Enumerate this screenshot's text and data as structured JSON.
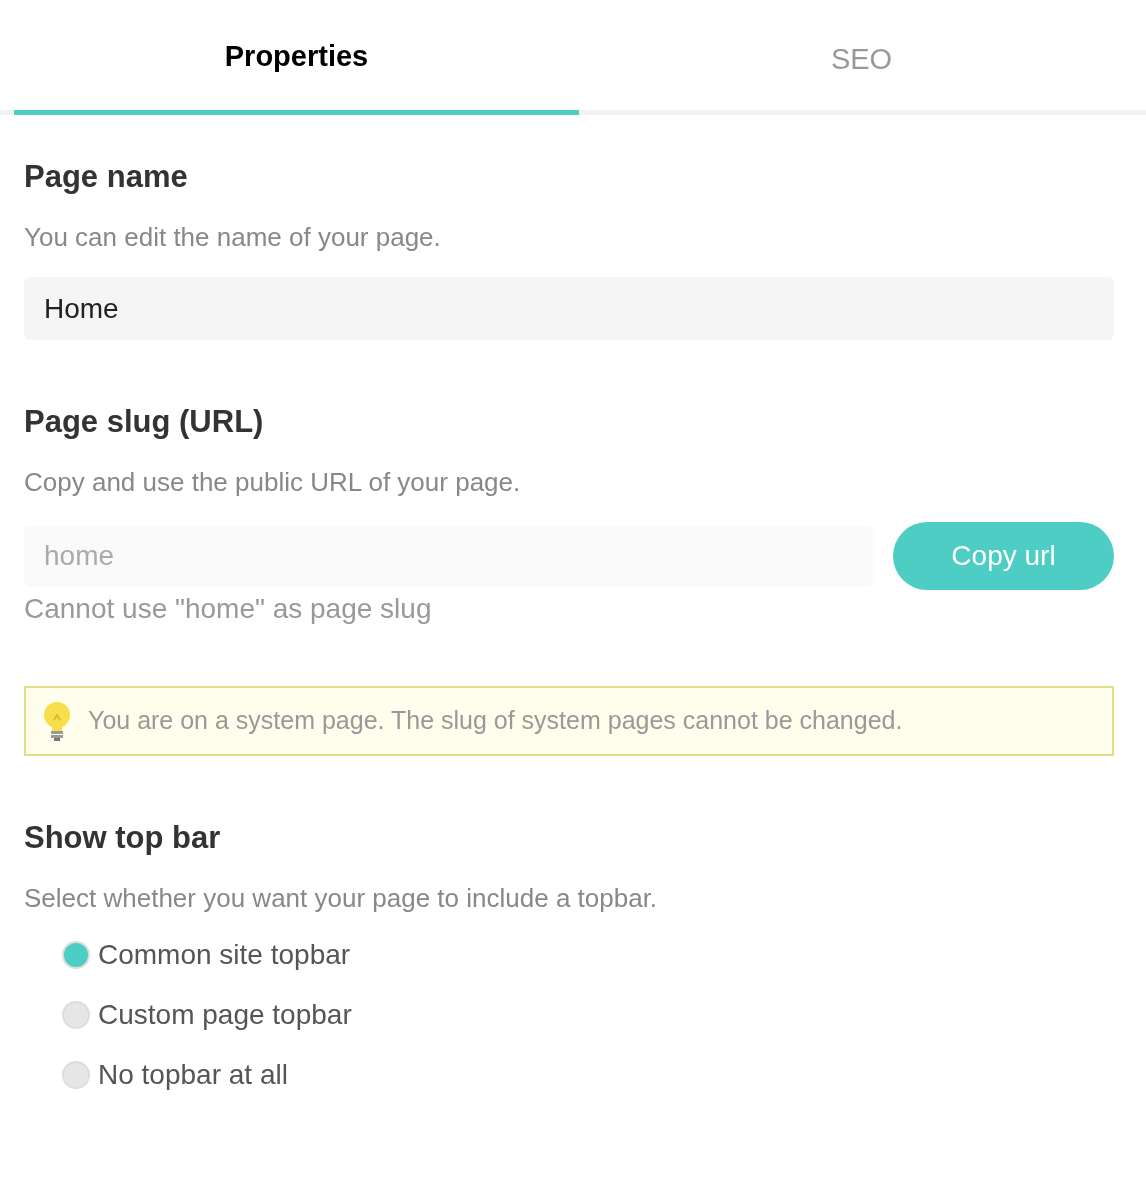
{
  "tabs": [
    {
      "label": "Properties",
      "selected": true
    },
    {
      "label": "SEO",
      "selected": false
    }
  ],
  "page_name": {
    "heading": "Page name",
    "description": "You can edit the name of your page.",
    "value": "Home"
  },
  "page_slug": {
    "heading": "Page slug (URL)",
    "description": "Copy and use the public URL of your page.",
    "placeholder": "home",
    "button": "Copy url",
    "error": "Cannot use \"home\" as page slug"
  },
  "notice": {
    "text": "You are on a system page. The slug of system pages cannot be changed."
  },
  "top_bar": {
    "heading": "Show top bar",
    "description": "Select whether you want your page to include a topbar.",
    "options": [
      {
        "label": "Common site topbar",
        "selected": true
      },
      {
        "label": "Custom page topbar",
        "selected": false
      },
      {
        "label": "No topbar at all",
        "selected": false
      }
    ]
  }
}
